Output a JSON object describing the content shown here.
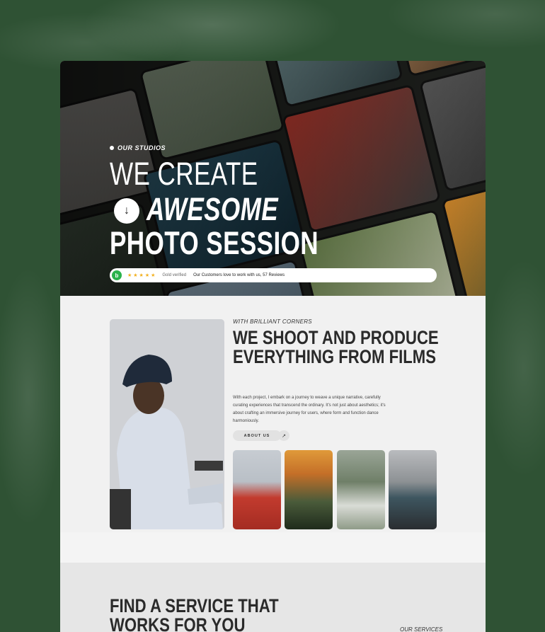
{
  "hero": {
    "eyebrow": "OUR STUDIOS",
    "line1": "WE CREATE",
    "line2": "AWESOME",
    "line3": "PHOTO SESSION",
    "down_icon": "arrow-down",
    "review": {
      "logo": "b",
      "stars": "★★★★★",
      "verified": "Gold verified",
      "text": "Our Customers love to work with us, 57 Reviews"
    }
  },
  "about": {
    "kicker": "WITH BRILLIANT CORNERS",
    "title": "WE SHOOT AND PRODUCE EVERYTHING FROM FILMS",
    "text": "With each project, I embark on a journey to weave a unique narrative, carefully curating experiences that transcend the ordinary. It's not just about aesthetics; it's about crafting an immersive journey for users, where form and function dance harmoniously.",
    "button": "ABOUT US",
    "button_icon": "↗"
  },
  "services": {
    "title": "FIND A SERVICE THAT WORKS FOR YOU",
    "kicker": "OUR SERVICES"
  },
  "colors": {
    "background": "#2f5234",
    "page": "#f1f1f1",
    "hero_dark": "#1d1f1c",
    "star": "#f2b01e",
    "brand_green": "#2bb24c"
  }
}
